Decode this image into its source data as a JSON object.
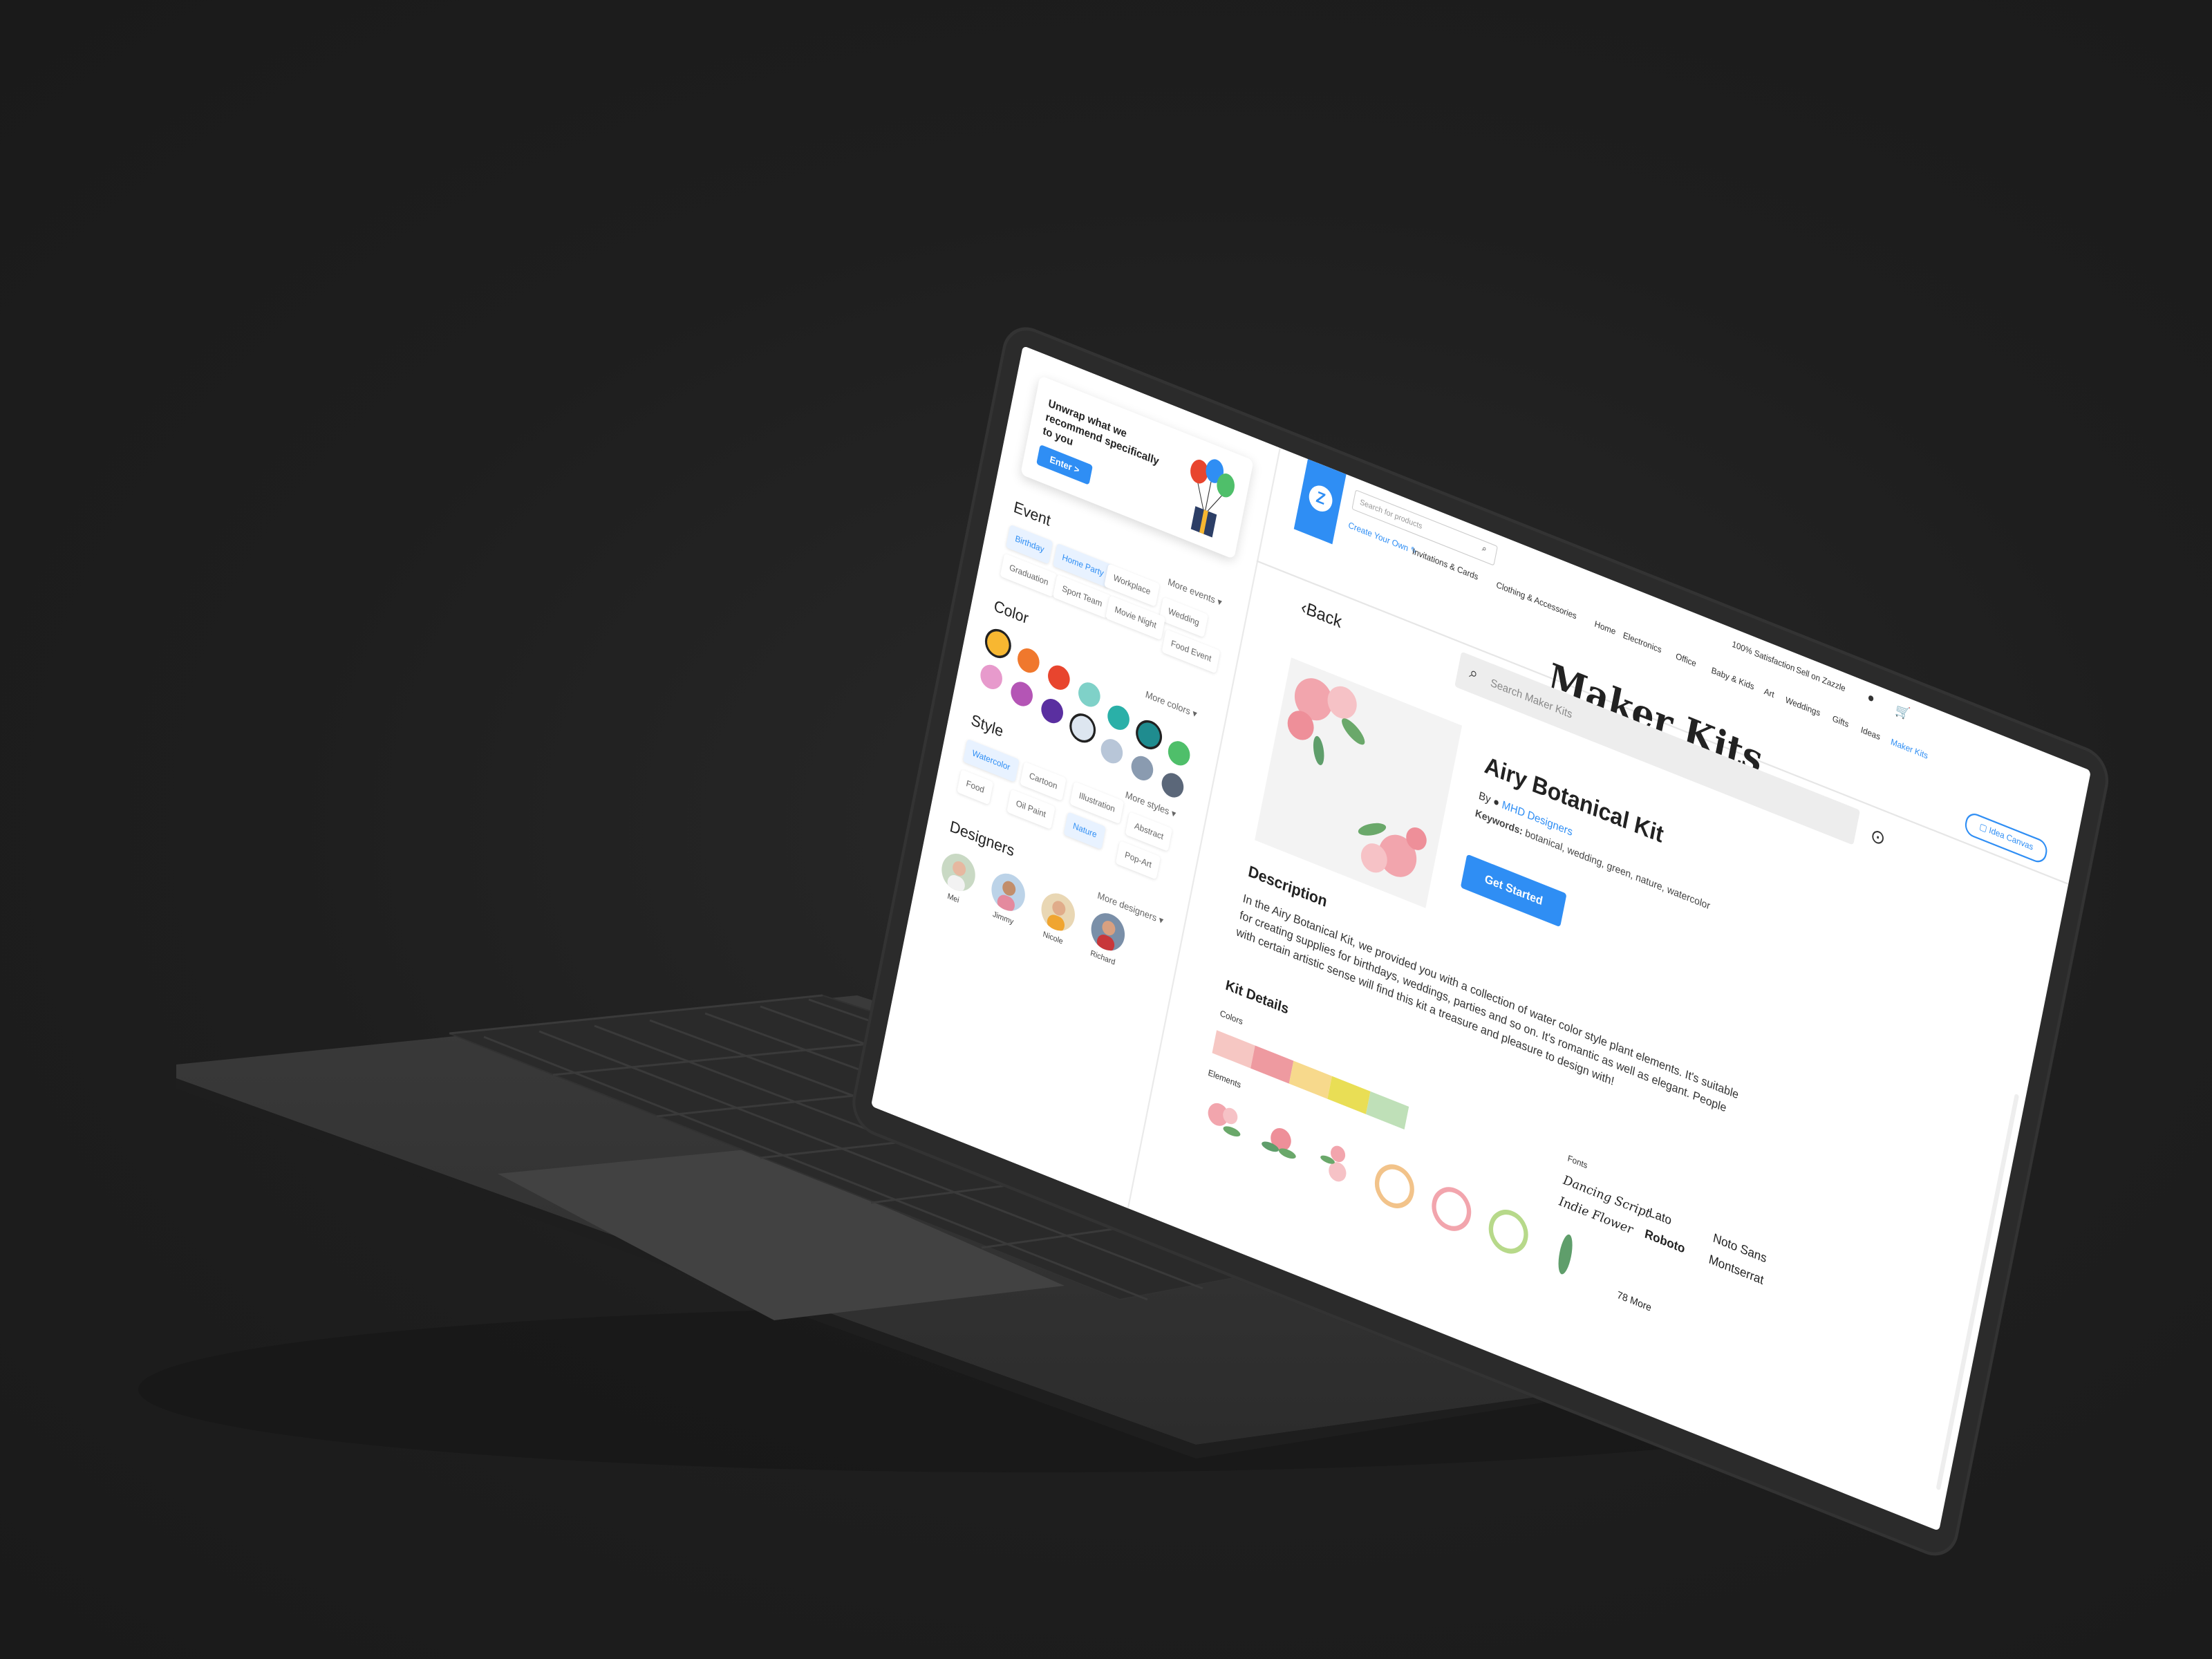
{
  "sidebar": {
    "promo": {
      "text": "Unwrap what we recommend specifically to you",
      "button": "Enter >"
    },
    "event": {
      "title": "Event",
      "chips": [
        "Birthday",
        "Home Party",
        "Graduation",
        "Workplace",
        "Sport Team",
        "Wedding",
        "Movie Night",
        "Food Event"
      ],
      "selected": [
        "Birthday",
        "Home Party"
      ],
      "more": "More events"
    },
    "color": {
      "title": "Color",
      "swatches": [
        "#f7b731",
        "#f0782d",
        "#e8452e",
        "#7fd1c8",
        "#e79acc",
        "#b455b5",
        "#5a2fa0",
        "#dde6f0",
        "#2ab0a8",
        "#1f8c8f",
        "#b8c6d8",
        "#8a9bb0",
        "#5b6779",
        "#4fbf6a"
      ],
      "more": "More colors"
    },
    "style": {
      "title": "Style",
      "chips": [
        "Watercolor",
        "Cartoon",
        "Illustration",
        "Food",
        "Oil Paint",
        "Nature",
        "Abstract",
        "Pop-Art"
      ],
      "selected": [
        "Watercolor",
        "Nature"
      ],
      "more": "More styles"
    },
    "designers": {
      "title": "Designers",
      "people": [
        "Mei",
        "Jimmy",
        "Nicole",
        "Richard"
      ],
      "more": "More designers"
    }
  },
  "header": {
    "search_placeholder": "Search for products",
    "create_own": "Create Your Own",
    "nav": [
      "Invitations & Cards",
      "Clothing & Accessories",
      "Home",
      "Electronics",
      "Office",
      "Baby & Kids",
      "Art",
      "Weddings",
      "Gifts",
      "Ideas",
      "Maker Kits"
    ],
    "active_nav": "Maker Kits",
    "satisfaction": "100% Satisfaction",
    "sell": "Sell on Zazzle",
    "idea_canvas": "Idea Canvas"
  },
  "page": {
    "title": "Maker Kits",
    "search_placeholder": "Search Maker Kits",
    "back": "Back"
  },
  "kit": {
    "name": "Airy Botanical Kit",
    "by_label": "By",
    "designer": "MHD Designers",
    "keywords_label": "Keywords:",
    "keywords": "botanical, wedding, green, nature, watercolor",
    "button": "Get Started",
    "description_title": "Description",
    "description": "In the Airy Botanical Kit, we provided you with a collection of water color style plant elements. It's suitable for creating supplies for birthdays, weddings, parties and so on. It's romantic as well as elegant. People with certain artistic sense will find this kit a treasure and pleasure to design with!",
    "details_title": "Kit Details",
    "colors_label": "Colors",
    "palette": [
      "#f6c7c3",
      "#ee9aa0",
      "#f7d98c",
      "#e9de55",
      "#bfe0b8"
    ],
    "elements_label": "Elements",
    "fonts_label": "Fonts",
    "fonts": [
      "Dancing Script",
      "Lato",
      "Noto Sans",
      "Indie Flower",
      "Roboto",
      "Montserrat"
    ],
    "more_count": "78 More"
  }
}
